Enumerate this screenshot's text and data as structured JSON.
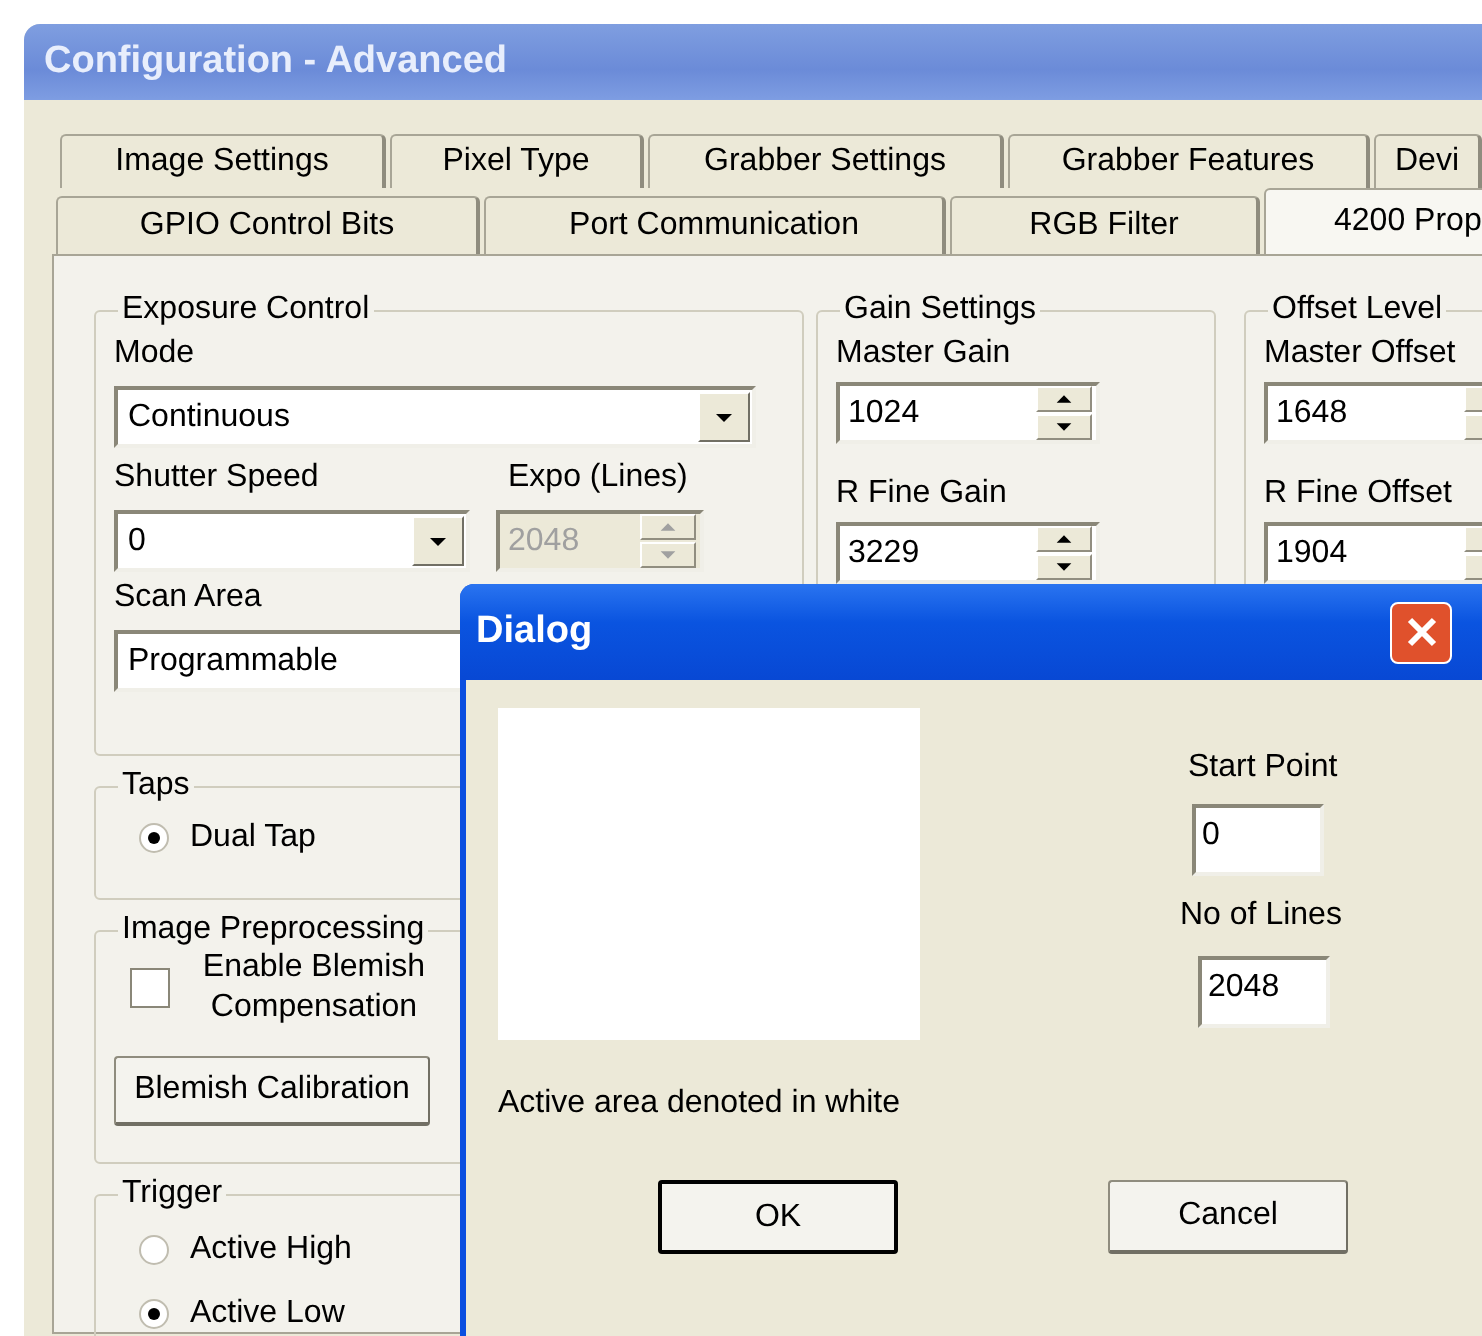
{
  "window": {
    "title": "Configuration - Advanced"
  },
  "tab_rows": [
    [
      {
        "label": "Image Settings",
        "selected": false
      },
      {
        "label": "Pixel Type",
        "selected": false
      },
      {
        "label": "Grabber Settings",
        "selected": false
      },
      {
        "label": "Grabber Features",
        "selected": false
      },
      {
        "label": "Devi",
        "selected": false
      }
    ],
    [
      {
        "label": "GPIO Control Bits",
        "selected": false
      },
      {
        "label": "Port Communication",
        "selected": false
      },
      {
        "label": "RGB Filter",
        "selected": false
      },
      {
        "label": "4200 Prop",
        "selected": true
      }
    ]
  ],
  "exposure_control": {
    "title": "Exposure Control",
    "mode": {
      "label": "Mode",
      "value": "Continuous"
    },
    "shutter_speed": {
      "label": "Shutter Speed",
      "value": "0"
    },
    "expo_lines": {
      "label": "Expo (Lines)",
      "value": "2048",
      "disabled": true
    },
    "scan_area": {
      "label": "Scan Area",
      "value": "Programmable"
    }
  },
  "taps": {
    "title": "Taps",
    "options": [
      {
        "label": "Dual Tap",
        "selected": true
      }
    ]
  },
  "image_preprocessing": {
    "title": "Image Preprocessing",
    "blemish_compensation": {
      "label": "Enable Blemish Compensation",
      "checked": false
    },
    "calibration_button": "Blemish Calibration"
  },
  "trigger": {
    "title": "Trigger",
    "options": [
      {
        "label": "Active High",
        "selected": false
      },
      {
        "label": "Active Low",
        "selected": true
      }
    ]
  },
  "gain_settings": {
    "title": "Gain Settings",
    "fields": [
      {
        "label": "Master Gain",
        "value": "1024"
      },
      {
        "label": "R Fine Gain",
        "value": "3229"
      }
    ]
  },
  "offset_level": {
    "title": "Offset Level",
    "fields": [
      {
        "label": "Master Offset",
        "value": "1648"
      },
      {
        "label": "R Fine Offset",
        "value": "1904"
      }
    ]
  },
  "dialog": {
    "title": "Dialog",
    "start_point": {
      "label": "Start Point",
      "value": "0"
    },
    "no_of_lines": {
      "label": "No of Lines",
      "value": "2048"
    },
    "caption": "Active area denoted in white",
    "buttons": [
      {
        "label": "OK",
        "default": true
      },
      {
        "label": "Cancel",
        "default": false
      }
    ]
  }
}
